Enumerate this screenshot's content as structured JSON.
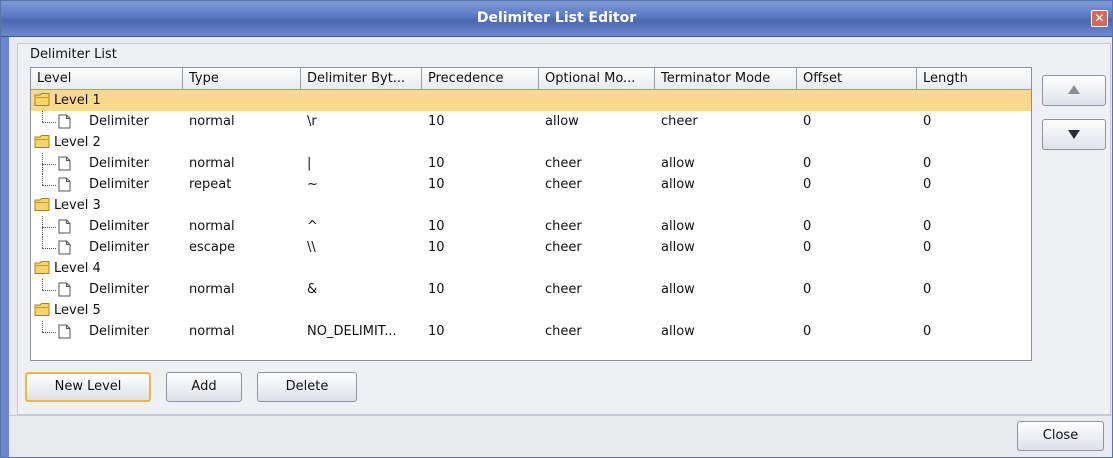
{
  "window": {
    "title": "Delimiter List Editor",
    "close_glyph": "✕"
  },
  "panel": {
    "label": "Delimiter List"
  },
  "table": {
    "columns": [
      "Level",
      "Type",
      "Delimiter Byt...",
      "Precedence",
      "Optional Mo...",
      "Terminator Mode",
      "Offset",
      "Length"
    ],
    "rows": [
      {
        "kind": "level",
        "label": "Level 1",
        "selected": true
      },
      {
        "kind": "delim",
        "label": "Delimiter",
        "type": "normal",
        "bytes": "\\r",
        "precedence": "10",
        "optional": "allow",
        "terminator": "cheer",
        "offset": "0",
        "length": "0",
        "last": true
      },
      {
        "kind": "level",
        "label": "Level 2"
      },
      {
        "kind": "delim",
        "label": "Delimiter",
        "type": "normal",
        "bytes": "|",
        "precedence": "10",
        "optional": "cheer",
        "terminator": "allow",
        "offset": "0",
        "length": "0"
      },
      {
        "kind": "delim",
        "label": "Delimiter",
        "type": "repeat",
        "bytes": "~",
        "precedence": "10",
        "optional": "cheer",
        "terminator": "allow",
        "offset": "0",
        "length": "0",
        "last": true
      },
      {
        "kind": "level",
        "label": "Level 3"
      },
      {
        "kind": "delim",
        "label": "Delimiter",
        "type": "normal",
        "bytes": "^",
        "precedence": "10",
        "optional": "cheer",
        "terminator": "allow",
        "offset": "0",
        "length": "0"
      },
      {
        "kind": "delim",
        "label": "Delimiter",
        "type": "escape",
        "bytes": "\\\\",
        "precedence": "10",
        "optional": "cheer",
        "terminator": "allow",
        "offset": "0",
        "length": "0",
        "last": true
      },
      {
        "kind": "level",
        "label": "Level 4"
      },
      {
        "kind": "delim",
        "label": "Delimiter",
        "type": "normal",
        "bytes": "&",
        "precedence": "10",
        "optional": "cheer",
        "terminator": "allow",
        "offset": "0",
        "length": "0",
        "last": true
      },
      {
        "kind": "level",
        "label": "Level 5"
      },
      {
        "kind": "delim",
        "label": "Delimiter",
        "type": "normal",
        "bytes": "NO_DELIMIT...",
        "precedence": "10",
        "optional": "cheer",
        "terminator": "allow",
        "offset": "0",
        "length": "0",
        "last": true
      }
    ]
  },
  "buttons": {
    "new_level": "New Level",
    "add": "Add",
    "delete": "Delete",
    "close": "Close",
    "move_up_icon": "up-arrow-icon",
    "move_down_icon": "down-arrow-icon"
  },
  "colors": {
    "selection": "#fbd98c",
    "titlebar": "#5b79c3",
    "default_button_border": "#e7b84a"
  }
}
